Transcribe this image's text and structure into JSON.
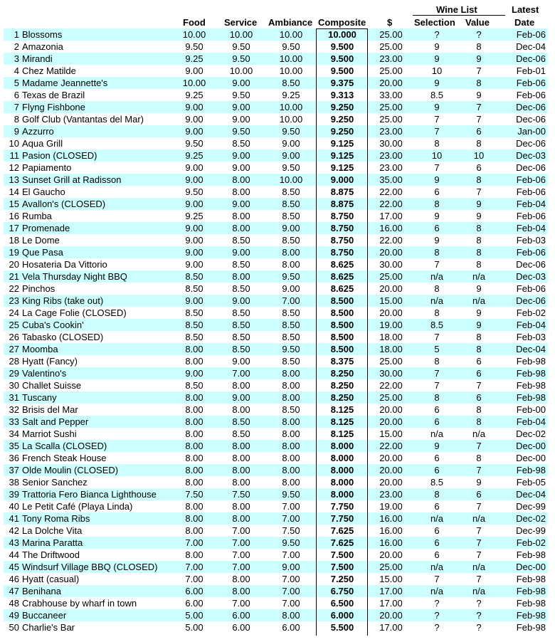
{
  "headers": {
    "food": "Food",
    "service": "Service",
    "ambiance": "Ambiance",
    "composite": "Composite",
    "price": "$",
    "wine_list": "Wine List",
    "selection": "Selection",
    "value": "Value",
    "latest": "Latest",
    "date": "Date"
  },
  "rows": [
    {
      "rank": "1",
      "name": "Blossoms",
      "food": "10.00",
      "service": "10.00",
      "ambiance": "10.00",
      "composite": "10.000",
      "price": "25.00",
      "selection": "?",
      "value": "?",
      "date": "Feb-06"
    },
    {
      "rank": "2",
      "name": "Amazonia",
      "food": "9.50",
      "service": "9.50",
      "ambiance": "9.50",
      "composite": "9.500",
      "price": "25.00",
      "selection": "9",
      "value": "8",
      "date": "Dec-04"
    },
    {
      "rank": "3",
      "name": "Mirandi",
      "food": "9.25",
      "service": "9.50",
      "ambiance": "10.00",
      "composite": "9.500",
      "price": "23.00",
      "selection": "9",
      "value": "9",
      "date": "Dec-06"
    },
    {
      "rank": "4",
      "name": "Chez Matilde",
      "food": "9.00",
      "service": "10.00",
      "ambiance": "10.00",
      "composite": "9.500",
      "price": "25.00",
      "selection": "10",
      "value": "7",
      "date": "Feb-01"
    },
    {
      "rank": "5",
      "name": "Madame Jeannette's",
      "food": "10.00",
      "service": "9.00",
      "ambiance": "8.50",
      "composite": "9.375",
      "price": "20.00",
      "selection": "9",
      "value": "8",
      "date": "Feb-06"
    },
    {
      "rank": "6",
      "name": "Texas de Brazil",
      "food": "9.25",
      "service": "9.50",
      "ambiance": "9.25",
      "composite": "9.313",
      "price": "33.00",
      "selection": "8.5",
      "value": "9",
      "date": "Feb-06"
    },
    {
      "rank": "7",
      "name": "Flyng Fishbone",
      "food": "9.00",
      "service": "9.00",
      "ambiance": "10.00",
      "composite": "9.250",
      "price": "25.00",
      "selection": "9",
      "value": "7",
      "date": "Dec-06"
    },
    {
      "rank": "8",
      "name": "Golf Club (Vantantas del Mar)",
      "food": "9.00",
      "service": "9.00",
      "ambiance": "10.00",
      "composite": "9.250",
      "price": "25.00",
      "selection": "7",
      "value": "7",
      "date": "Dec-06"
    },
    {
      "rank": "9",
      "name": "Azzurro",
      "food": "9.00",
      "service": "9.50",
      "ambiance": "9.50",
      "composite": "9.250",
      "price": "23.00",
      "selection": "7",
      "value": "6",
      "date": "Jan-00"
    },
    {
      "rank": "10",
      "name": "Aqua Grill",
      "food": "9.50",
      "service": "8.50",
      "ambiance": "9.00",
      "composite": "9.125",
      "price": "30.00",
      "selection": "8",
      "value": "8",
      "date": "Dec-06"
    },
    {
      "rank": "11",
      "name": "Pasion (CLOSED)",
      "food": "9.25",
      "service": "9.00",
      "ambiance": "9.00",
      "composite": "9.125",
      "price": "23.00",
      "selection": "10",
      "value": "10",
      "date": "Dec-03"
    },
    {
      "rank": "12",
      "name": "Papiamento",
      "food": "9.00",
      "service": "9.00",
      "ambiance": "9.50",
      "composite": "9.125",
      "price": "23.00",
      "selection": "7",
      "value": "6",
      "date": "Dec-06"
    },
    {
      "rank": "13",
      "name": "Sunset Grill at Radisson",
      "food": "9.00",
      "service": "8.00",
      "ambiance": "10.00",
      "composite": "9.000",
      "price": "35.00",
      "selection": "9",
      "value": "8",
      "date": "Feb-06"
    },
    {
      "rank": "14",
      "name": "El Gaucho",
      "food": "9.50",
      "service": "8.00",
      "ambiance": "8.50",
      "composite": "8.875",
      "price": "22.00",
      "selection": "6",
      "value": "7",
      "date": "Feb-06"
    },
    {
      "rank": "15",
      "name": "Avallon's (CLOSED)",
      "food": "9.00",
      "service": "9.00",
      "ambiance": "8.50",
      "composite": "8.875",
      "price": "22.00",
      "selection": "8",
      "value": "9",
      "date": "Feb-04"
    },
    {
      "rank": "16",
      "name": "Rumba",
      "food": "9.25",
      "service": "8.00",
      "ambiance": "8.50",
      "composite": "8.750",
      "price": "17.00",
      "selection": "9",
      "value": "9",
      "date": "Feb-06"
    },
    {
      "rank": "17",
      "name": "Promenade",
      "food": "9.00",
      "service": "8.00",
      "ambiance": "9.00",
      "composite": "8.750",
      "price": "16.00",
      "selection": "6",
      "value": "8",
      "date": "Feb-04"
    },
    {
      "rank": "18",
      "name": "Le Dome",
      "food": "9.00",
      "service": "8.50",
      "ambiance": "8.50",
      "composite": "8.750",
      "price": "22.00",
      "selection": "9",
      "value": "8",
      "date": "Feb-03"
    },
    {
      "rank": "19",
      "name": "Que Pasa",
      "food": "9.00",
      "service": "9.00",
      "ambiance": "8.00",
      "composite": "8.750",
      "price": "20.00",
      "selection": "8",
      "value": "8",
      "date": "Feb-06"
    },
    {
      "rank": "20",
      "name": "Hosateria Da Vittorio",
      "food": "9.00",
      "service": "8.50",
      "ambiance": "8.00",
      "composite": "8.625",
      "price": "30.00",
      "selection": "7",
      "value": "8",
      "date": "Dec-06"
    },
    {
      "rank": "21",
      "name": "Vela Thursday Night BBQ",
      "food": "8.50",
      "service": "8.00",
      "ambiance": "9.50",
      "composite": "8.625",
      "price": "25.00",
      "selection": "n/a",
      "value": "n/a",
      "date": "Dec-03"
    },
    {
      "rank": "22",
      "name": "Pinchos",
      "food": "8.50",
      "service": "8.50",
      "ambiance": "9.00",
      "composite": "8.625",
      "price": "20.00",
      "selection": "8",
      "value": "9",
      "date": "Feb-06"
    },
    {
      "rank": "23",
      "name": "King Ribs (take out)",
      "food": "9.00",
      "service": "9.00",
      "ambiance": "7.00",
      "composite": "8.500",
      "price": "15.00",
      "selection": "n/a",
      "value": "n/a",
      "date": "Dec-06"
    },
    {
      "rank": "24",
      "name": "La Cage Folie (CLOSED)",
      "food": "8.50",
      "service": "8.50",
      "ambiance": "8.50",
      "composite": "8.500",
      "price": "20.00",
      "selection": "8",
      "value": "9",
      "date": "Feb-02"
    },
    {
      "rank": "25",
      "name": "Cuba's Cookin'",
      "food": "8.50",
      "service": "8.50",
      "ambiance": "8.50",
      "composite": "8.500",
      "price": "19.00",
      "selection": "8.5",
      "value": "9",
      "date": "Feb-04"
    },
    {
      "rank": "26",
      "name": "Tabasko (CLOSED)",
      "food": "8.50",
      "service": "8.50",
      "ambiance": "8.50",
      "composite": "8.500",
      "price": "18.00",
      "selection": "7",
      "value": "8",
      "date": "Feb-03"
    },
    {
      "rank": "27",
      "name": "Moomba",
      "food": "8.00",
      "service": "8.50",
      "ambiance": "9.50",
      "composite": "8.500",
      "price": "18.00",
      "selection": "5",
      "value": "8",
      "date": "Dec-04"
    },
    {
      "rank": "28",
      "name": "Hyatt  (Fancy)",
      "food": "8.00",
      "service": "9.00",
      "ambiance": "8.50",
      "composite": "8.375",
      "price": "25.00",
      "selection": "8",
      "value": "6",
      "date": "Feb-98"
    },
    {
      "rank": "29",
      "name": "Valentino's",
      "food": "9.00",
      "service": "7.00",
      "ambiance": "8.00",
      "composite": "8.250",
      "price": "30.00",
      "selection": "7",
      "value": "6",
      "date": "Feb-98"
    },
    {
      "rank": "30",
      "name": "Challet Suisse",
      "food": "8.50",
      "service": "8.00",
      "ambiance": "8.00",
      "composite": "8.250",
      "price": "22.00",
      "selection": "7",
      "value": "7",
      "date": "Feb-98"
    },
    {
      "rank": "31",
      "name": "Tuscany",
      "food": "8.00",
      "service": "9.00",
      "ambiance": "8.00",
      "composite": "8.250",
      "price": "25.00",
      "selection": "8",
      "value": "6",
      "date": "Feb-98"
    },
    {
      "rank": "32",
      "name": "Brisis del Mar",
      "food": "8.00",
      "service": "8.00",
      "ambiance": "8.50",
      "composite": "8.125",
      "price": "20.00",
      "selection": "6",
      "value": "8",
      "date": "Feb-00"
    },
    {
      "rank": "33",
      "name": "Salt and Pepper",
      "food": "8.00",
      "service": "8.50",
      "ambiance": "8.00",
      "composite": "8.125",
      "price": "20.00",
      "selection": "6",
      "value": "8",
      "date": "Feb-04"
    },
    {
      "rank": "34",
      "name": "Marriot Sushi",
      "food": "8.00",
      "service": "8.50",
      "ambiance": "8.00",
      "composite": "8.125",
      "price": "15.00",
      "selection": "n/a",
      "value": "n/a",
      "date": "Dec-02"
    },
    {
      "rank": "35",
      "name": "La Scalla (CLOSED)",
      "food": "8.00",
      "service": "8.00",
      "ambiance": "8.00",
      "composite": "8.000",
      "price": "22.00",
      "selection": "9",
      "value": "7",
      "date": "Dec-00"
    },
    {
      "rank": "36",
      "name": "French Steak House",
      "food": "8.00",
      "service": "8.00",
      "ambiance": "8.00",
      "composite": "8.000",
      "price": "20.00",
      "selection": "6",
      "value": "8",
      "date": "Dec-00"
    },
    {
      "rank": "37",
      "name": "Olde Moulin (CLOSED)",
      "food": "8.00",
      "service": "8.00",
      "ambiance": "8.00",
      "composite": "8.000",
      "price": "20.00",
      "selection": "6",
      "value": "7",
      "date": "Feb-98"
    },
    {
      "rank": "38",
      "name": "Senior Sanchez",
      "food": "8.00",
      "service": "8.00",
      "ambiance": "8.00",
      "composite": "8.000",
      "price": "20.00",
      "selection": "8.5",
      "value": "9",
      "date": "Feb-05"
    },
    {
      "rank": "39",
      "name": "Trattoria Fero Bianca Lighthouse",
      "food": "7.50",
      "service": "7.50",
      "ambiance": "9.50",
      "composite": "8.000",
      "price": "23.00",
      "selection": "8",
      "value": "6",
      "date": "Dec-04"
    },
    {
      "rank": "40",
      "name": "Le Petit Café (Playa Linda)",
      "food": "8.00",
      "service": "8.00",
      "ambiance": "7.00",
      "composite": "7.750",
      "price": "19.00",
      "selection": "6",
      "value": "7",
      "date": "Dec-99"
    },
    {
      "rank": "41",
      "name": "Tony Roma Ribs",
      "food": "8.00",
      "service": "8.00",
      "ambiance": "7.00",
      "composite": "7.750",
      "price": "16.00",
      "selection": "n/a",
      "value": "n/a",
      "date": "Dec-02"
    },
    {
      "rank": "42",
      "name": "La Dolche Vita",
      "food": "8.00",
      "service": "7.00",
      "ambiance": "7.50",
      "composite": "7.625",
      "price": "16.00",
      "selection": "6",
      "value": "7",
      "date": "Dec-99"
    },
    {
      "rank": "43",
      "name": "Marina Paratta",
      "food": "7.00",
      "service": "7.00",
      "ambiance": "9.50",
      "composite": "7.625",
      "price": "16.00",
      "selection": "6",
      "value": "7",
      "date": "Feb-02"
    },
    {
      "rank": "44",
      "name": "The Driftwood",
      "food": "8.00",
      "service": "7.00",
      "ambiance": "7.00",
      "composite": "7.500",
      "price": "20.00",
      "selection": "6",
      "value": "7",
      "date": "Feb-98"
    },
    {
      "rank": "45",
      "name": "Windsurf Village BBQ (CLOSED)",
      "food": "7.00",
      "service": "7.00",
      "ambiance": "9.00",
      "composite": "7.500",
      "price": "25.00",
      "selection": "n/a",
      "value": "n/a",
      "date": "Dec-00"
    },
    {
      "rank": "46",
      "name": "Hyatt (casual)",
      "food": "7.00",
      "service": "8.00",
      "ambiance": "7.00",
      "composite": "7.250",
      "price": "15.00",
      "selection": "7",
      "value": "7",
      "date": "Feb-98"
    },
    {
      "rank": "47",
      "name": "Benihana",
      "food": "6.00",
      "service": "8.00",
      "ambiance": "7.00",
      "composite": "6.750",
      "price": "17.00",
      "selection": "n/a",
      "value": "n/a",
      "date": "Feb-98"
    },
    {
      "rank": "48",
      "name": "Crabhouse by wharf in town",
      "food": "6.00",
      "service": "7.00",
      "ambiance": "7.00",
      "composite": "6.500",
      "price": "17.00",
      "selection": "?",
      "value": "?",
      "date": "Feb-98"
    },
    {
      "rank": "49",
      "name": "Buccaneer",
      "food": "5.00",
      "service": "6.00",
      "ambiance": "8.00",
      "composite": "6.000",
      "price": "20.00",
      "selection": "?",
      "value": "?",
      "date": "Feb-98"
    },
    {
      "rank": "50",
      "name": "Charlie's Bar",
      "food": "5.00",
      "service": "6.00",
      "ambiance": "6.00",
      "composite": "5.500",
      "price": "17.00",
      "selection": "?",
      "value": "?",
      "date": "Feb-98"
    }
  ],
  "colors": {
    "row_shade": "#ccffff",
    "text": "#000000"
  }
}
